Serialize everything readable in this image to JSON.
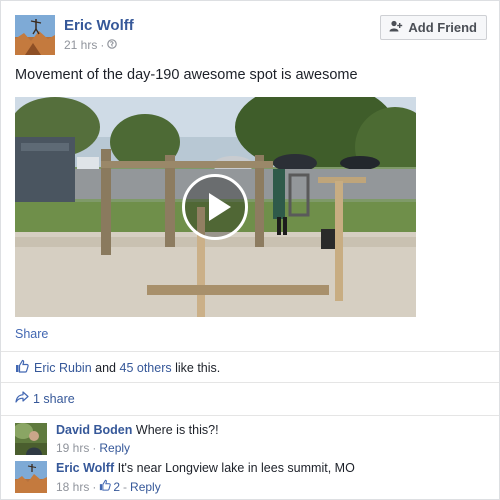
{
  "post": {
    "author": "Eric Wolff",
    "time": "21 hrs",
    "separator": "·",
    "privacy_icon": "globe-icon",
    "add_friend_label": "Add Friend",
    "text": "Movement of the day-190 awesome spot is awesome",
    "video_icon": "play-icon",
    "share_label": "Share"
  },
  "likes": {
    "first_name": "Eric Rubin",
    "and_text": "and",
    "others": "45 others",
    "suffix": "like this."
  },
  "shares": {
    "label": "1 share"
  },
  "comments": [
    {
      "author": "David Boden",
      "text": "Where is this?!",
      "time": "19 hrs",
      "separator": "·",
      "reply_label": "Reply"
    },
    {
      "author": "Eric Wolff",
      "text": "It's near Longview lake in lees summit, MO",
      "time": "18 hrs",
      "separator": "·",
      "like_count": "2",
      "separator2": "-",
      "reply_label": "Reply"
    }
  ],
  "colors": {
    "link": "#365899",
    "meta": "#90949c",
    "button_bg": "#f6f7f9"
  }
}
